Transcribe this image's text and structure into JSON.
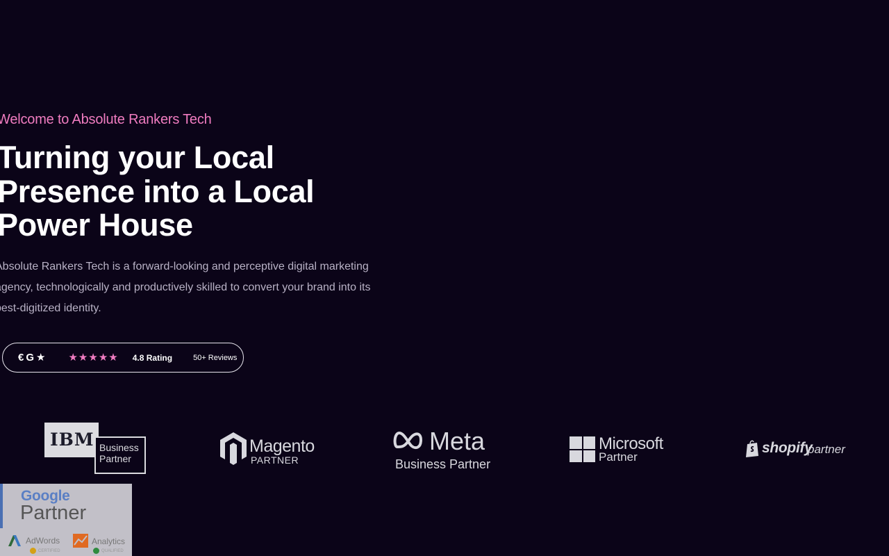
{
  "hero": {
    "eyebrow": "Welcome to Absolute Rankers Tech",
    "headline_lines": [
      "Turning your Local",
      "Presence into a Local",
      "Power House"
    ],
    "description": "Absolute Rankers Tech is a forward-looking and perceptive digital marketing agency, technologically and productively skilled to convert your brand into its best-digitized identity."
  },
  "rating": {
    "icons": [
      "clutch-icon",
      "google-icon",
      "star-icon"
    ],
    "stars": 5,
    "rating_label": "4.8 Rating",
    "reviews_label": "50+ Reviews",
    "star_color": "#ef7cc1"
  },
  "partners": {
    "ibm": {
      "word": "IBM",
      "line1": "Business",
      "line2": "Partner"
    },
    "magento": {
      "word": "Magento",
      "sub": "PARTNER"
    },
    "meta": {
      "word": "Meta",
      "sub": "Business Partner"
    },
    "microsoft": {
      "word": "Microsoft",
      "sub": "Partner"
    },
    "shopify": {
      "word": "shopify",
      "sub": "partner"
    },
    "google": {
      "word": "Google",
      "sub": "Partner",
      "adwords": "AdWords",
      "analytics": "Analytics",
      "certified": "CERTIFIED",
      "qualified": "QUALIFIED"
    }
  },
  "colors": {
    "background": "#0b0418",
    "accent": "#f07cc0",
    "text_muted": "#b9b2c6"
  }
}
